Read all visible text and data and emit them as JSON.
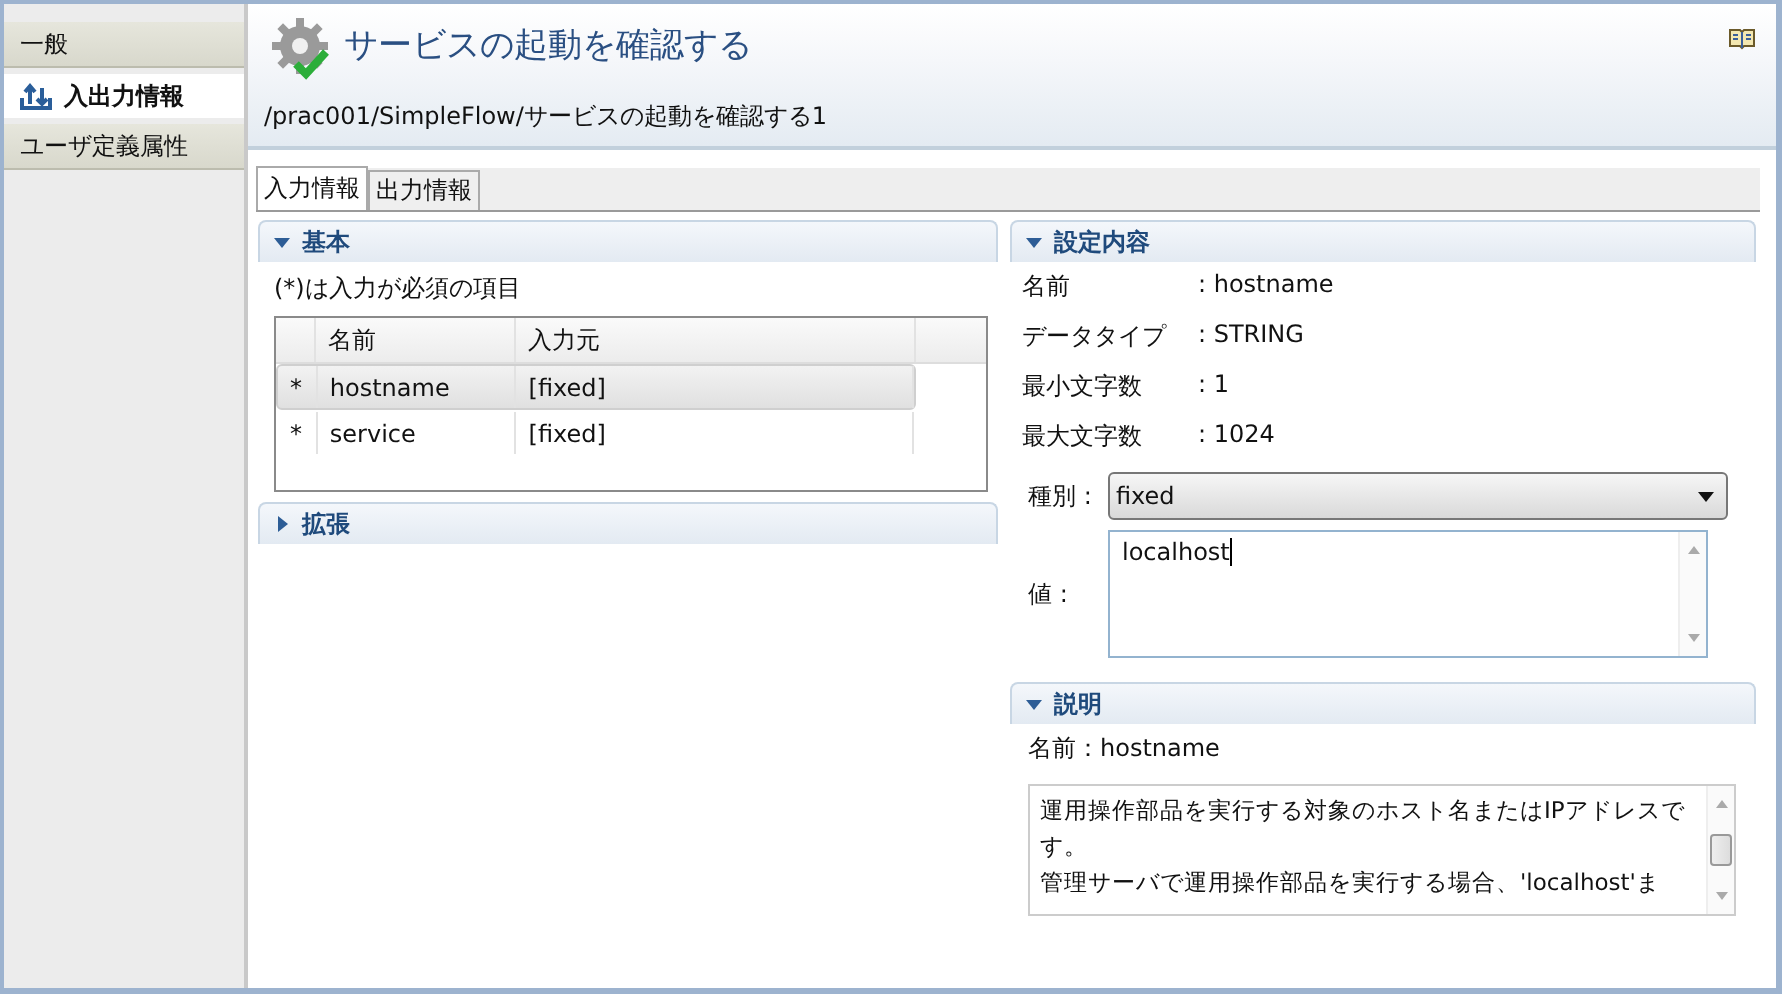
{
  "sidebar": {
    "items": [
      {
        "label": "一般",
        "selected": false
      },
      {
        "label": "入出力情報",
        "selected": true
      },
      {
        "label": "ユーザ定義属性",
        "selected": false
      }
    ]
  },
  "header": {
    "title": "サービスの起動を確認する",
    "path": "/prac001/SimpleFlow/サービスの起動を確認する1"
  },
  "tabs": [
    {
      "label": "入力情報",
      "selected": true
    },
    {
      "label": "出力情報",
      "selected": false
    }
  ],
  "basic_section": {
    "title": "基本",
    "expanded": true,
    "note": "(*)は入力が必須の項目",
    "table": {
      "columns": [
        "名前",
        "入力元"
      ],
      "rows": [
        {
          "required": "*",
          "name": "hostname",
          "source": "[fixed]",
          "selected": true
        },
        {
          "required": "*",
          "name": "service",
          "source": "[fixed]",
          "selected": false
        }
      ]
    }
  },
  "extension_section": {
    "title": "拡張",
    "expanded": false
  },
  "settings_section": {
    "title": "設定内容",
    "expanded": true,
    "properties": [
      {
        "label": "名前",
        "value": ": hostname"
      },
      {
        "label": "データタイプ",
        "value": ": STRING"
      },
      {
        "label": "最小文字数",
        "value": ": 1"
      },
      {
        "label": "最大文字数",
        "value": ": 1024"
      }
    ],
    "type_label": "種別 :",
    "type_value": "fixed",
    "value_label": "値 :",
    "value": "localhost"
  },
  "description_section": {
    "title": "説明",
    "expanded": true,
    "name": "名前：hostname",
    "paragraphs": [
      "運用操作部品を実行する対象のホスト名またはIPアドレスです。",
      "管理サーバで運用操作部品を実行する場合、'localhost'ま"
    ]
  }
}
